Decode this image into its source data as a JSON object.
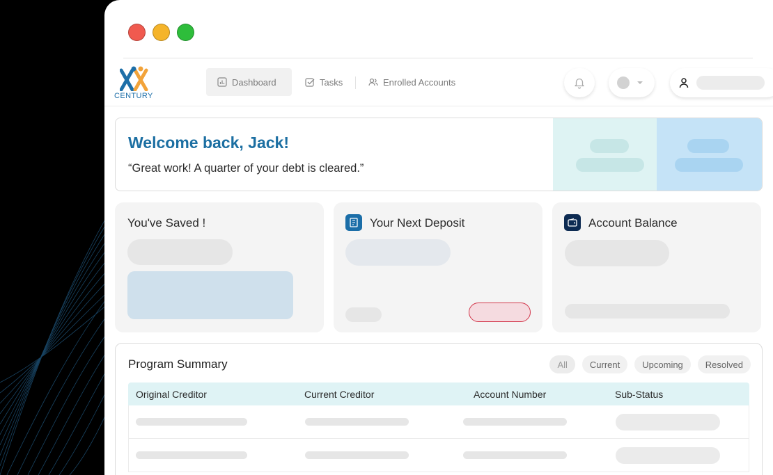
{
  "window": {
    "controls": [
      "close",
      "minimize",
      "maximize"
    ]
  },
  "brand": {
    "logo_text": "CENTURY",
    "colors": {
      "blue": "#1e6fa8",
      "orange": "#f2a33a"
    }
  },
  "nav": {
    "tabs": [
      {
        "label": "Dashboard",
        "icon": "bar-chart-icon",
        "active": true
      },
      {
        "label": "Tasks",
        "icon": "checkbox-icon",
        "active": false
      },
      {
        "label": "Enrolled Accounts",
        "icon": "users-icon",
        "active": false
      }
    ],
    "actions": {
      "notifications_icon": "bell-icon",
      "language_icon": "chevron-down-icon",
      "user_icon": "user-icon"
    }
  },
  "welcome": {
    "title": "Welcome back, Jack!",
    "quote": "“Great work! A quarter of your debt is cleared.”"
  },
  "cards": {
    "saved": {
      "title": "You've Saved !"
    },
    "deposit": {
      "title": "Your Next Deposit",
      "icon": "document-icon"
    },
    "balance": {
      "title": "Account Balance",
      "icon": "wallet-icon"
    }
  },
  "program_summary": {
    "title": "Program Summary",
    "filters": [
      "All",
      "Current",
      "Upcoming",
      "Resolved"
    ],
    "columns": [
      "Original Creditor",
      "Current Creditor",
      "Account Number",
      "Sub-Status"
    ],
    "row_count": 2
  },
  "colors": {
    "accent": "#1c6fa2",
    "header_bg": "#dff3f5",
    "deposit_button_border": "#d2364a"
  }
}
